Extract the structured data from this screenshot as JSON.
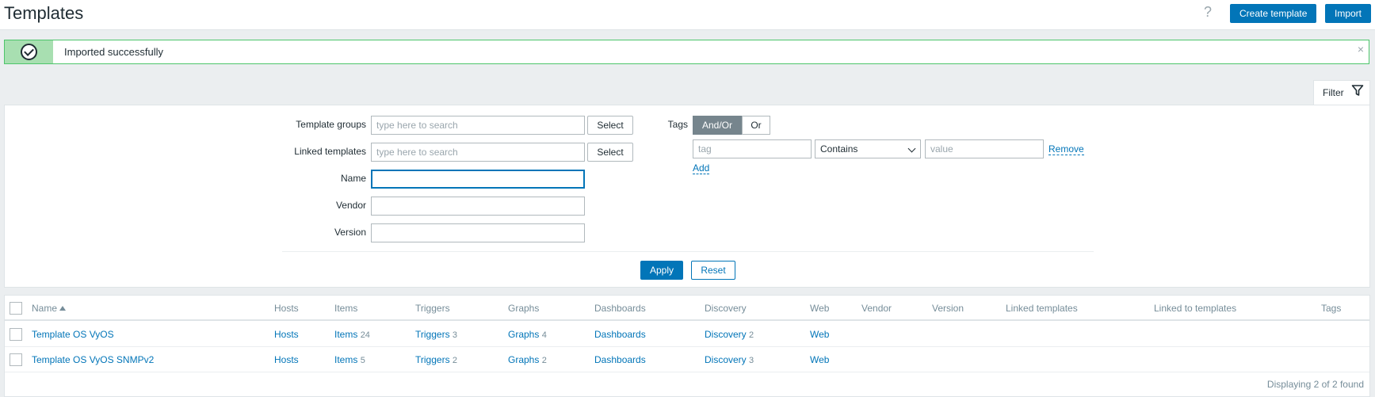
{
  "header": {
    "title": "Templates",
    "help_icon": "?",
    "create_label": "Create template",
    "import_label": "Import"
  },
  "message": {
    "text": "Imported successfully",
    "close_icon": "×",
    "type": "success"
  },
  "filter": {
    "tab_label": "Filter",
    "template_groups_label": "Template groups",
    "template_groups_placeholder": "type here to search",
    "linked_templates_label": "Linked templates",
    "linked_templates_placeholder": "type here to search",
    "select_label": "Select",
    "name_label": "Name",
    "name_value": "",
    "vendor_label": "Vendor",
    "vendor_value": "",
    "version_label": "Version",
    "version_value": "",
    "tags_label": "Tags",
    "tags_andor": "And/Or",
    "tags_or": "Or",
    "tag_placeholder": "tag",
    "tag_operator": "Contains",
    "value_placeholder": "value",
    "remove_label": "Remove",
    "add_label": "Add",
    "apply_label": "Apply",
    "reset_label": "Reset"
  },
  "table": {
    "columns": [
      "Name",
      "Hosts",
      "Items",
      "Triggers",
      "Graphs",
      "Dashboards",
      "Discovery",
      "Web",
      "Vendor",
      "Version",
      "Linked templates",
      "Linked to templates",
      "Tags"
    ],
    "rows": [
      {
        "name": "Template OS VyOS",
        "hosts": "Hosts",
        "items": "Items",
        "items_count": "24",
        "triggers": "Triggers",
        "triggers_count": "3",
        "graphs": "Graphs",
        "graphs_count": "4",
        "dashboards": "Dashboards",
        "discovery": "Discovery",
        "discovery_count": "2",
        "web": "Web"
      },
      {
        "name": "Template OS VyOS SNMPv2",
        "hosts": "Hosts",
        "items": "Items",
        "items_count": "5",
        "triggers": "Triggers",
        "triggers_count": "2",
        "graphs": "Graphs",
        "graphs_count": "2",
        "dashboards": "Dashboards",
        "discovery": "Discovery",
        "discovery_count": "3",
        "web": "Web"
      }
    ],
    "footer": "Displaying 2 of 2 found"
  },
  "colors": {
    "primary": "#0275b8",
    "success_border": "#4dc56b",
    "success_icon_bg": "#a8dfb1"
  }
}
